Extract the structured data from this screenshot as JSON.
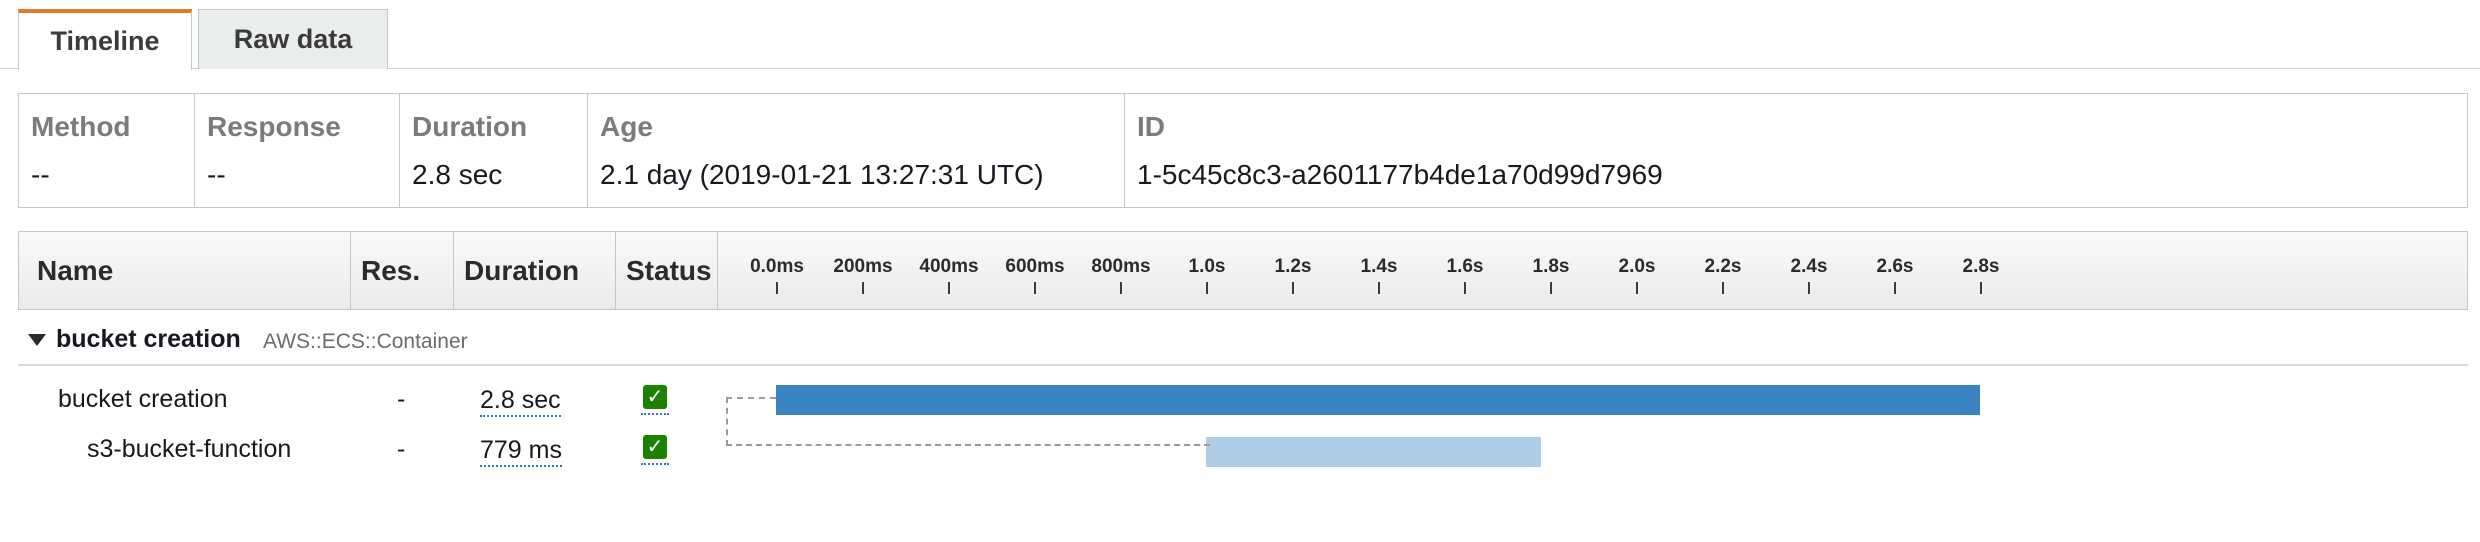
{
  "tabs": [
    {
      "label": "Timeline",
      "active": true
    },
    {
      "label": "Raw data",
      "active": false
    }
  ],
  "summary": {
    "method": {
      "label": "Method",
      "value": "--"
    },
    "response": {
      "label": "Response",
      "value": "--"
    },
    "duration": {
      "label": "Duration",
      "value": "2.8 sec"
    },
    "age": {
      "label": "Age",
      "value": "2.1 day (2019-01-21 13:27:31 UTC)"
    },
    "id": {
      "label": "ID",
      "value": "1-5c45c8c3-a2601177b4de1a70d99d7969"
    }
  },
  "timeline": {
    "columns": {
      "name": "Name",
      "res": "Res.",
      "duration": "Duration",
      "status": "Status"
    },
    "ticks": [
      "0.0ms",
      "200ms",
      "400ms",
      "600ms",
      "800ms",
      "1.0s",
      "1.2s",
      "1.4s",
      "1.6s",
      "1.8s",
      "2.0s",
      "2.2s",
      "2.4s",
      "2.6s",
      "2.8s"
    ],
    "group": {
      "name": "bucket creation",
      "type": "AWS::ECS::Container",
      "expanded": true
    },
    "segments": [
      {
        "name": "bucket creation",
        "res": "-",
        "duration": "2.8 sec",
        "status": "ok",
        "start_s": 0.0,
        "end_s": 2.8
      },
      {
        "name": "s3-bucket-function",
        "res": "-",
        "duration": "779 ms",
        "status": "ok",
        "start_s": 1.0,
        "end_s": 1.779
      }
    ]
  },
  "colors": {
    "tab_accent": "#e07b29",
    "bar_main": "#3a84c0",
    "bar_child": "#aecce6",
    "status_ok": "#1d8102"
  },
  "icons": {
    "status": "checkmark-icon",
    "group_toggle": "caret-down-icon"
  }
}
